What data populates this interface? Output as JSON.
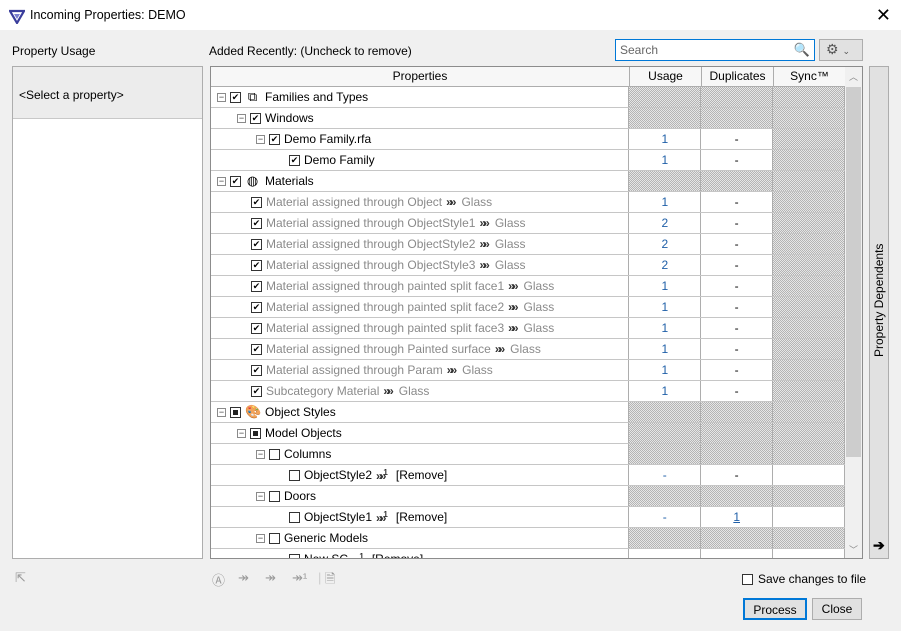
{
  "window": {
    "title": "Incoming Properties: DEMO"
  },
  "left": {
    "heading": "Property Usage",
    "placeholder": "<Select a property>"
  },
  "main": {
    "heading": "Added Recently: (Uncheck to remove)",
    "search_placeholder": "Search"
  },
  "columns": [
    "Properties",
    "Usage",
    "Duplicates",
    "Sync™"
  ],
  "rows": [
    {
      "level": 0,
      "exp": true,
      "check": "checked",
      "icon": "families-icon",
      "label": "Families and Types",
      "gray": false,
      "group": true
    },
    {
      "level": 1,
      "exp": true,
      "check": "checked",
      "label": "Windows",
      "group": true
    },
    {
      "level": 2,
      "exp": true,
      "check": "checked",
      "label": "Demo Family.rfa",
      "usage": "1",
      "dup": "-"
    },
    {
      "level": 3,
      "check": "checked",
      "label": "Demo Family",
      "usage": "1",
      "dup": "-"
    },
    {
      "level": 0,
      "exp": true,
      "check": "checked",
      "icon": "materials-icon",
      "label": "Materials",
      "group": true
    },
    {
      "level": 1,
      "check": "checked",
      "label": "Material assigned through Object",
      "gray": true,
      "target": "Glass",
      "usage": "1",
      "dup": "-"
    },
    {
      "level": 1,
      "check": "checked",
      "label": "Material assigned through ObjectStyle1",
      "gray": true,
      "target": "Glass",
      "usage": "2",
      "dup": "-"
    },
    {
      "level": 1,
      "check": "checked",
      "label": "Material assigned through ObjectStyle2",
      "gray": true,
      "target": "Glass",
      "usage": "2",
      "dup": "-"
    },
    {
      "level": 1,
      "check": "checked",
      "label": "Material assigned through ObjectStyle3",
      "gray": true,
      "target": "Glass",
      "usage": "2",
      "dup": "-"
    },
    {
      "level": 1,
      "check": "checked",
      "label": "Material assigned through painted split face1",
      "gray": true,
      "target": "Glass",
      "usage": "1",
      "dup": "-"
    },
    {
      "level": 1,
      "check": "checked",
      "label": "Material assigned through painted split face2",
      "gray": true,
      "target": "Glass",
      "usage": "1",
      "dup": "-"
    },
    {
      "level": 1,
      "check": "checked",
      "label": "Material assigned through painted split face3",
      "gray": true,
      "target": "Glass",
      "usage": "1",
      "dup": "-"
    },
    {
      "level": 1,
      "check": "checked",
      "label": "Material assigned through Painted surface",
      "gray": true,
      "target": "Glass",
      "usage": "1",
      "dup": "-"
    },
    {
      "level": 1,
      "check": "checked",
      "label": "Material assigned through Param",
      "gray": true,
      "target": "Glass",
      "usage": "1",
      "dup": "-"
    },
    {
      "level": 1,
      "check": "checked",
      "label": "Subcategory Material",
      "gray": true,
      "target": "Glass",
      "usage": "1",
      "dup": "-"
    },
    {
      "level": 0,
      "exp": true,
      "check": "partial",
      "icon": "object-styles-icon",
      "label": "Object Styles",
      "group": true
    },
    {
      "level": 1,
      "exp": true,
      "check": "partial",
      "label": "Model Objects",
      "group": true
    },
    {
      "level": 2,
      "exp": true,
      "check": "none",
      "label": "Columns",
      "group": true
    },
    {
      "level": 3,
      "check": "none",
      "label": "ObjectStyle2",
      "remove": "[Remove]",
      "usage": "-",
      "dup": "-",
      "syncwhite": true
    },
    {
      "level": 2,
      "exp": true,
      "check": "none",
      "label": "Doors",
      "group": true
    },
    {
      "level": 3,
      "check": "none",
      "label": "ObjectStyle1",
      "remove": "[Remove]",
      "usage": "-",
      "dup": "1",
      "syncwhite": true,
      "duplink": true
    },
    {
      "level": 2,
      "exp": true,
      "check": "none",
      "label": "Generic Models",
      "group": true
    },
    {
      "level": 3,
      "check": "none",
      "label": "New SC",
      "remove": "[Remove]",
      "usage": "",
      "dup": "",
      "syncwhite": true
    }
  ],
  "side": {
    "label": "Property Dependents"
  },
  "footer": {
    "save_label": "Save changes to file",
    "process": "Process",
    "close": "Close"
  }
}
